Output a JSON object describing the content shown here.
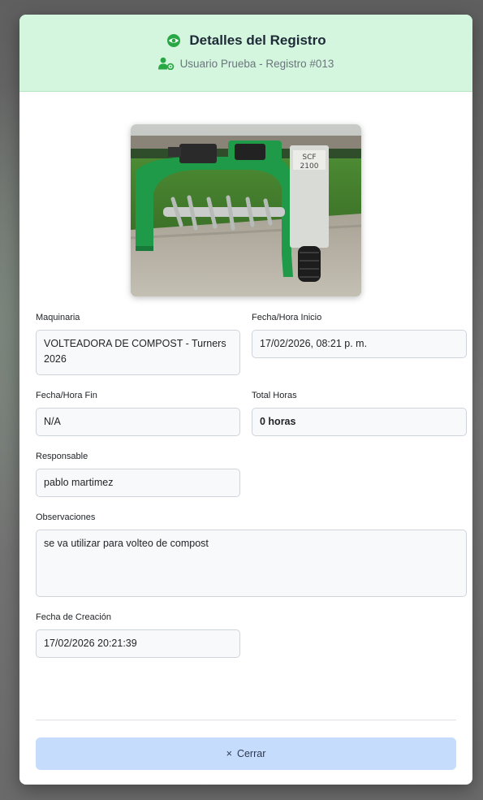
{
  "modal": {
    "title": "Detalles del Registro",
    "subtitle": "Usuario Prueba - Registro #013",
    "icons": {
      "title": "eye-icon",
      "subtitle": "user-gear-icon",
      "close": "x-icon"
    },
    "colors": {
      "header_bg": "#d4f6df",
      "accent": "#28a745",
      "close_bg": "#c6dcfd"
    }
  },
  "photo": {
    "sign_text": "SCF 2100"
  },
  "fields": {
    "maquinaria": {
      "label": "Maquinaria",
      "value": "VOLTEADORA DE COMPOST - Turners 2026"
    },
    "inicio": {
      "label": "Fecha/Hora Inicio",
      "value": "17/02/2026, 08:21 p. m."
    },
    "fin": {
      "label": "Fecha/Hora Fin",
      "value": "N/A"
    },
    "total": {
      "label": "Total Horas",
      "value": "0 horas"
    },
    "responsable": {
      "label": "Responsable",
      "value": "pablo martimez"
    },
    "observaciones": {
      "label": "Observaciones",
      "value": "se va utilizar para volteo de compost"
    },
    "creacion": {
      "label": "Fecha de Creación",
      "value": "17/02/2026 20:21:39"
    }
  },
  "footer": {
    "close_symbol": "×",
    "close_label": "Cerrar"
  }
}
